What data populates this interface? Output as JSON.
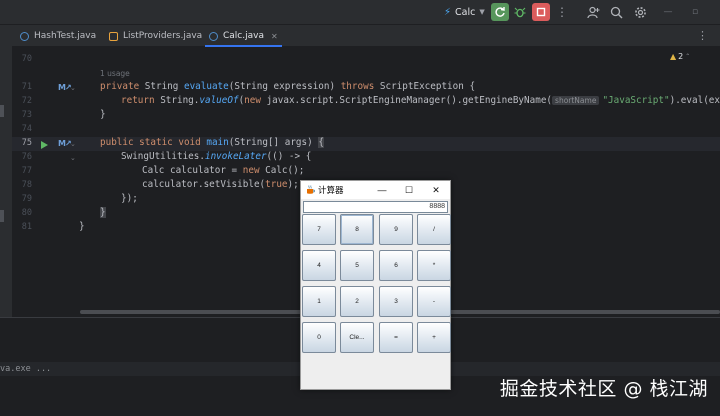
{
  "toolbar": {
    "run_config": "Calc",
    "icons": [
      "rerun-icon",
      "debug-icon",
      "stop-icon",
      "more-icon",
      "add-user-icon",
      "search-icon",
      "settings-icon"
    ]
  },
  "tabs": [
    {
      "label": "HashTest.java",
      "active": false
    },
    {
      "label": "ListProviders.java",
      "active": false
    },
    {
      "label": "Calc.java",
      "active": true
    }
  ],
  "editor": {
    "warnings_count": "2",
    "usage_hint": "1 usage",
    "param_hint": "shortName",
    "lines": [
      {
        "num": "70"
      },
      {
        "num": "71"
      },
      {
        "num": "72"
      },
      {
        "num": "73"
      },
      {
        "num": "74"
      },
      {
        "num": "75"
      },
      {
        "num": "76"
      },
      {
        "num": "77"
      },
      {
        "num": "78"
      },
      {
        "num": "79"
      },
      {
        "num": "80"
      },
      {
        "num": "81"
      }
    ],
    "code": {
      "l71_a": "private ",
      "l71_b": "String ",
      "l71_c": "evaluate",
      "l71_d": "(String expression) ",
      "l71_e": "throws ",
      "l71_f": "ScriptException {",
      "l72_a": "return ",
      "l72_b": "String.",
      "l72_c": "valueOf",
      "l72_d": "(",
      "l72_e": "new ",
      "l72_f": "javax.script.ScriptEngineManager().getEngineByName(",
      "l72_g": "\"JavaScript\"",
      "l72_h": ").eval(expressi",
      "l73": "}",
      "l75_a": "public static void ",
      "l75_b": "main",
      "l75_c": "(String[] args) ",
      "l75_d": "{",
      "l76_a": "SwingUtilities.",
      "l76_b": "invokeLater",
      "l76_c": "(() -> {",
      "l77_a": "Calc calculator = ",
      "l77_b": "new ",
      "l77_c": "Calc();",
      "l78_a": "calculator.setVisible(",
      "l78_b": "true",
      "l78_c": ");",
      "l79": "});",
      "l80": "}",
      "l81": "}"
    }
  },
  "run_panel": {
    "status_text": "va.exe ..."
  },
  "calculator": {
    "title": "计算器",
    "display": "8888",
    "buttons": [
      [
        "7",
        "8",
        "9",
        "/"
      ],
      [
        "4",
        "5",
        "6",
        "*"
      ],
      [
        "1",
        "2",
        "3",
        "-"
      ],
      [
        "0",
        "Cle...",
        "=",
        "+"
      ]
    ]
  },
  "watermark": "掘金技术社区 @ 栈江湖"
}
